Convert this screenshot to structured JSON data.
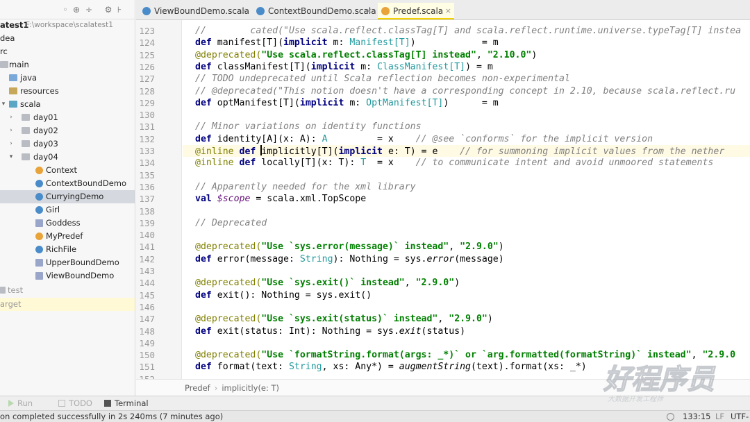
{
  "project": {
    "root_name": "atest1",
    "root_path": "F:\\workspace\\scalatest1",
    "items": [
      {
        "label": "dea"
      },
      {
        "label": "rc"
      },
      {
        "label": "main"
      },
      {
        "label": "java"
      },
      {
        "label": "resources"
      },
      {
        "label": "scala"
      },
      {
        "label": "day01"
      },
      {
        "label": "day02"
      },
      {
        "label": "day03"
      },
      {
        "label": "day04"
      },
      {
        "label": "Context"
      },
      {
        "label": "ContextBoundDemo"
      },
      {
        "label": "CurryingDemo"
      },
      {
        "label": "Girl"
      },
      {
        "label": "Goddess"
      },
      {
        "label": "MyPredef"
      },
      {
        "label": "RichFile"
      },
      {
        "label": "UpperBoundDemo"
      },
      {
        "label": "ViewBoundDemo"
      },
      {
        "label": "test"
      },
      {
        "label": "arget"
      }
    ]
  },
  "tabs": [
    {
      "label": "ViewBoundDemo.scala",
      "close": "×"
    },
    {
      "label": "ContextBoundDemo.scala",
      "close": "×"
    },
    {
      "label": "Predef.scala",
      "close": "×"
    }
  ],
  "editor": {
    "line_numbers": [
      "123",
      "124",
      "125",
      "126",
      "127",
      "128",
      "129",
      "130",
      "131",
      "132",
      "133",
      "134",
      "135",
      "136",
      "137",
      "138",
      "139",
      "140",
      "141",
      "142",
      "143",
      "144",
      "145",
      "146",
      "147",
      "148",
      "149",
      "150",
      "151",
      "152"
    ],
    "line_123": "//        cated(\"Use scala.reflect.classTag[T] and scala.reflect.runtime.universe.typeTag[T] instea",
    "line_124_a": "def",
    "line_124_b": " manifest[T](",
    "line_124_c": "implicit",
    "line_124_d": " m: ",
    "line_124_e": "Manifest[T]",
    "line_124_f": ")            = m",
    "line_125_a": "@deprecated(",
    "line_125_b": "\"Use scala.reflect.classTag[T] instead\"",
    "line_125_c": ", ",
    "line_125_d": "\"2.10.0\"",
    "line_125_e": ")",
    "line_126_a": "def",
    "line_126_b": " classManifest[T](",
    "line_126_c": "implicit",
    "line_126_d": " m: ",
    "line_126_e": "ClassManifest[T]",
    "line_126_f": ") = m",
    "line_127": "// TODO undeprecated until Scala reflection becomes non-experimental",
    "line_128": "// @deprecated(\"This notion doesn't have a corresponding concept in 2.10, because scala.reflect.ru",
    "line_129_a": "def",
    "line_129_b": " optManifest[T](",
    "line_129_c": "implicit",
    "line_129_d": " m: ",
    "line_129_e": "OptManifest[T]",
    "line_129_f": ")      = m",
    "line_131": "// Minor variations on identity functions",
    "line_132_a": "def",
    "line_132_b": " identity[A](x: A): ",
    "line_132_c": "A",
    "line_132_d": "         = x    ",
    "line_132_e": "// @see `conforms` for the implicit version",
    "line_133_a": "@inline ",
    "line_133_b": "def",
    "line_133_c": " ",
    "line_133_d": "implicitly[T](",
    "line_133_e": "implicit",
    "line_133_f": " e: T) = e    ",
    "line_133_g": "// for summoning implicit values from the nether ",
    "line_134_a": "@inline ",
    "line_134_b": "def",
    "line_134_c": " locally[T](x: T): ",
    "line_134_d": "T",
    "line_134_e": "  = x    ",
    "line_134_f": "// to communicate intent and avoid unmoored statements",
    "line_136": "// Apparently needed for the xml library",
    "line_137_a": "val",
    "line_137_b": " ",
    "line_137_c": "$scope",
    "line_137_d": " = scala.xml.TopScope",
    "line_139": "// Deprecated",
    "line_141_a": "@deprecated(",
    "line_141_b": "\"Use `sys.error(message)` instead\"",
    "line_141_c": ", ",
    "line_141_d": "\"2.9.0\"",
    "line_141_e": ")",
    "line_142_a": "def",
    "line_142_b": " error(message: ",
    "line_142_c": "String",
    "line_142_d": "): Nothing = sys.",
    "line_142_e": "error",
    "line_142_f": "(message)",
    "line_144_a": "@deprecated(",
    "line_144_b": "\"Use `sys.exit()` instead\"",
    "line_144_c": ", ",
    "line_144_d": "\"2.9.0\"",
    "line_144_e": ")",
    "line_145_a": "def",
    "line_145_b": " exit(): Nothing = sys.exit()",
    "line_147_a": "@deprecated(",
    "line_147_b": "\"Use `sys.exit(status)` instead\"",
    "line_147_c": ", ",
    "line_147_d": "\"2.9.0\"",
    "line_147_e": ")",
    "line_148_a": "def",
    "line_148_b": " exit(status: Int): Nothing = sys.",
    "line_148_c": "exit",
    "line_148_d": "(status)",
    "line_150_a": "@deprecated(",
    "line_150_b": "\"Use `formatString.format(args: _*)` or `arg.formatted(formatString)` instead\"",
    "line_150_c": ", ",
    "line_150_d": "\"2.9.0",
    "line_151_a": "def",
    "line_151_b": " format(text: ",
    "line_151_c": "String",
    "line_151_d": ", xs: Any*) = ",
    "line_151_e": "augmentString",
    "line_151_f": "(text).format(xs: _*)"
  },
  "breadcrumb": {
    "object": "Predef",
    "method": "implicitly(e: T)"
  },
  "tool_windows": {
    "run": "Run",
    "todo": "TODO",
    "terminal": "Terminal"
  },
  "status": {
    "message": "on completed successfully in 2s 240ms (7 minutes ago)",
    "position": "133:15",
    "line_sep": "LF",
    "encoding": "UTF-"
  },
  "colors": {
    "keyword": "#000080",
    "string": "#008000",
    "annotation": "#808000",
    "comment": "#808080",
    "type": "#20999d"
  },
  "watermark": {
    "text": "好程序员",
    "subtext": "大数据开发工程师"
  }
}
